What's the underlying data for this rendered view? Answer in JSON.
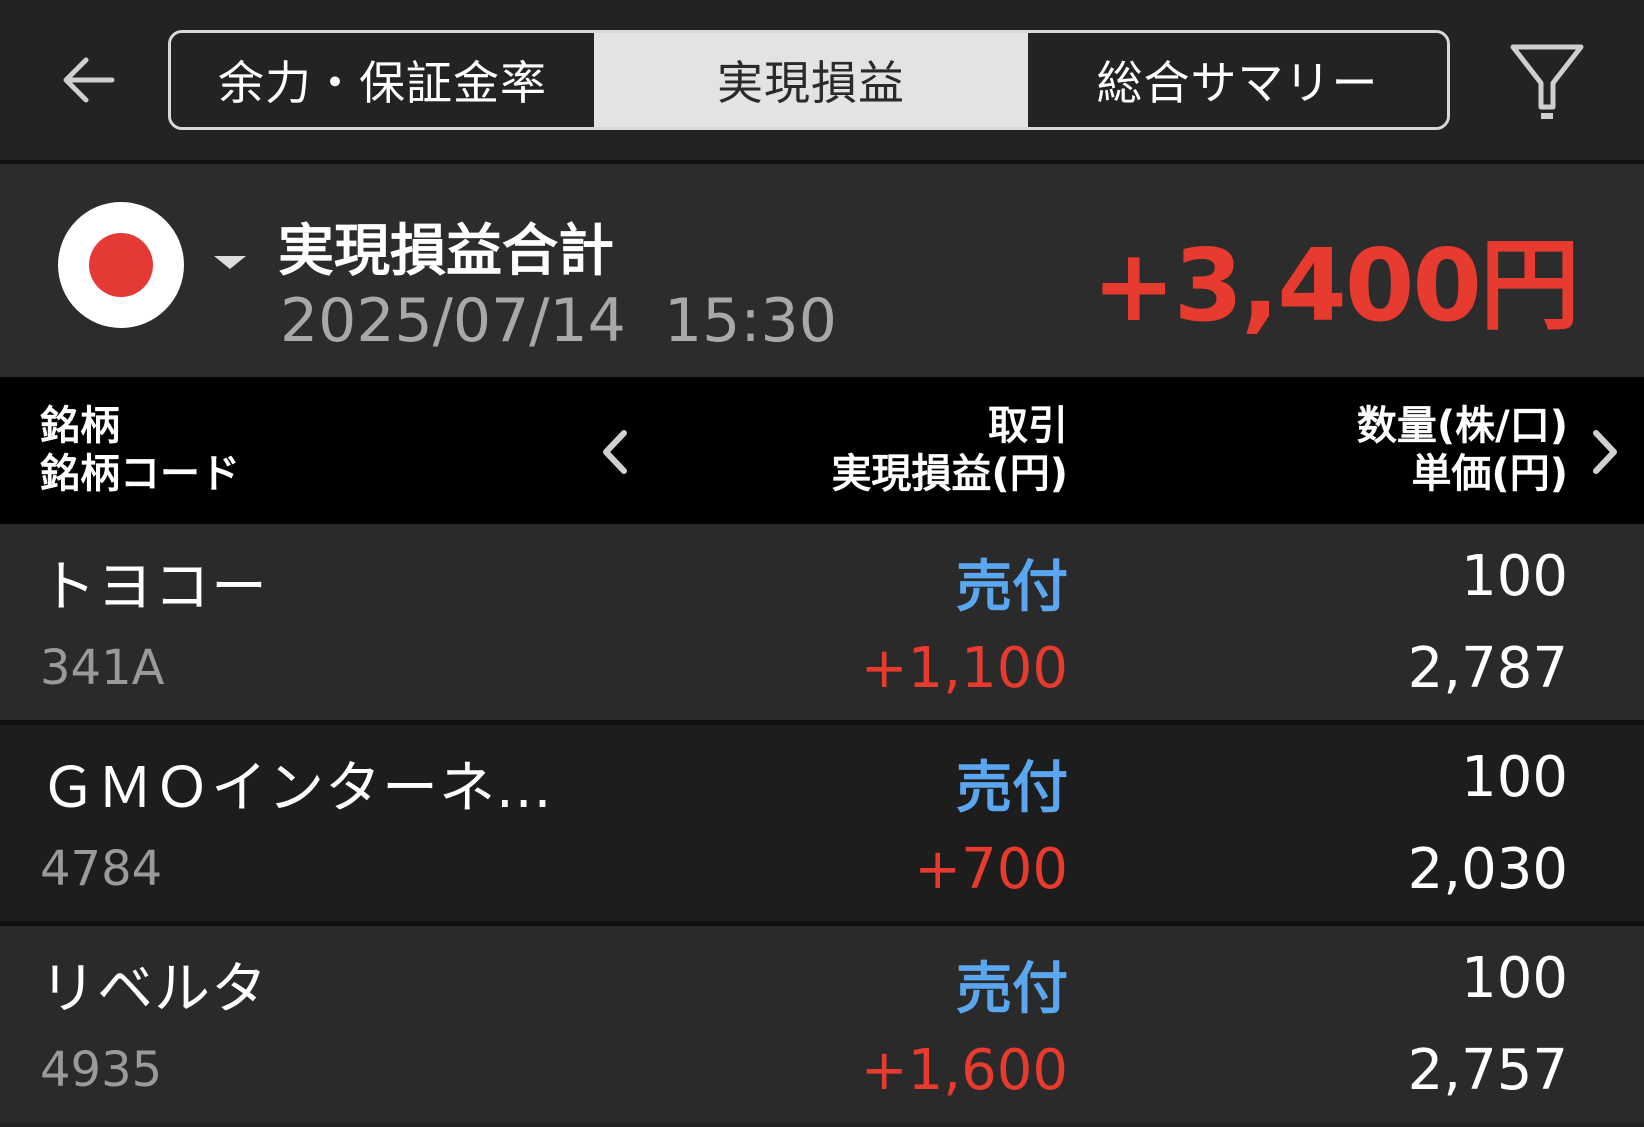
{
  "header": {
    "tabs": [
      {
        "label": "余力・保証金率",
        "active": false
      },
      {
        "label": "実現損益",
        "active": true
      },
      {
        "label": "総合サマリー",
        "active": false
      }
    ],
    "back_icon": "arrow-left-icon",
    "filter_icon": "filter-icon"
  },
  "summary": {
    "market_icon": "japan-flag-icon",
    "title": "実現損益合計",
    "datetime": "2025/07/14  15:30",
    "total": "+3,400円"
  },
  "columns": {
    "name": "銘柄",
    "code": "銘柄コード",
    "trade": "取引",
    "pl": "実現損益(円)",
    "qty": "数量(株/口)",
    "price": "単価(円)"
  },
  "rows": [
    {
      "name": "トヨコー",
      "code": "341A",
      "trade": "売付",
      "pl": "+1,100",
      "qty": "100",
      "price": "2,787"
    },
    {
      "name": "ＧＭＯインターネ...",
      "code": "4784",
      "trade": "売付",
      "pl": "+700",
      "qty": "100",
      "price": "2,030"
    },
    {
      "name": "リベルタ",
      "code": "4935",
      "trade": "売付",
      "pl": "+1,600",
      "qty": "100",
      "price": "2,757"
    }
  ],
  "colors": {
    "profit": "#e63b2e",
    "trade": "#5aa6ef",
    "background": "#232323"
  }
}
